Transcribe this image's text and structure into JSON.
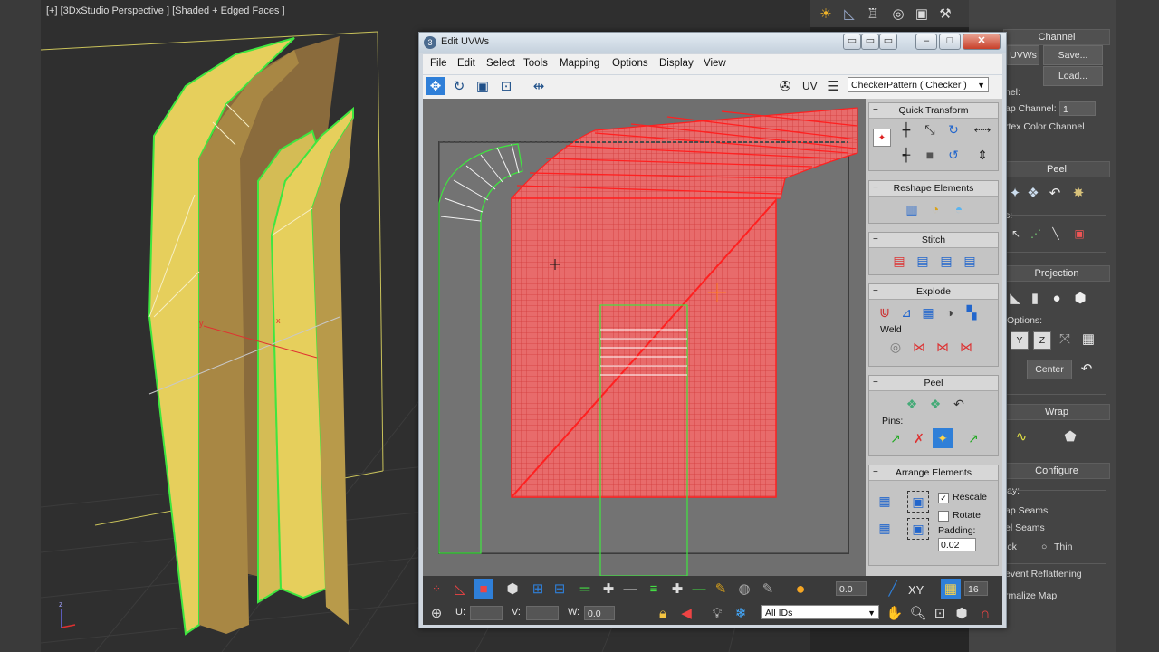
{
  "viewport": {
    "label": "[+] [3DxStudio Perspective ] [Shaded + Edged Faces ]",
    "axis_x": "x",
    "axis_y": "y",
    "axis_z": "z"
  },
  "uvw_window": {
    "title": "Edit UVWs",
    "menu": [
      "File",
      "Edit",
      "Select",
      "Tools",
      "Mapping",
      "Options",
      "Display",
      "View"
    ],
    "uv_label": "UV",
    "checker_pattern": "CheckerPattern  ( Checker )",
    "panels": {
      "quick_transform": "Quick Transform",
      "reshape_elements": "Reshape Elements",
      "stitch": "Stitch",
      "explode": "Explode",
      "weld": "Weld",
      "peel": "Peel",
      "pins": "Pins:",
      "arrange_elements": "Arrange Elements",
      "rescale": "Rescale",
      "rotate": "Rotate",
      "padding_label": "Padding:",
      "padding_value": "0.02"
    },
    "bottom": {
      "soft_value": "0.0",
      "xy_label": "XY",
      "grid_value": "16",
      "u_label": "U:",
      "v_label": "V:",
      "w_label": "W:",
      "w_value": "0.0",
      "ids_select": "All IDs"
    }
  },
  "command_panel": {
    "channel": "Channel",
    "uvws_btn": "UVWs",
    "save_btn": "Save...",
    "load_btn": "Load...",
    "nel_text": "nel:",
    "map_channel_label": "ap Channel:",
    "map_channel_value": "1",
    "vertex_color": "rtex Color Channel",
    "peel": "Peel",
    "s_text": "s:",
    "projection": "Projection",
    "options": "Options:",
    "y_btn": "Y",
    "z_btn": "Z",
    "center_btn": "Center",
    "wrap": "Wrap",
    "configure": "Configure",
    "ay_text": "ay:",
    "map_seams": "ap Seams",
    "peel_seams": "el Seams",
    "thick": "ick",
    "thin": "Thin",
    "prevent_reflattening": "event Reflattening",
    "normalize_map": "rmalize Map"
  },
  "colors": {
    "uv_red": "#ff2020",
    "uv_green": "#3fe63f",
    "mesh_yellow": "#e6cf5c",
    "selection_blue": "#2f7fd8"
  }
}
